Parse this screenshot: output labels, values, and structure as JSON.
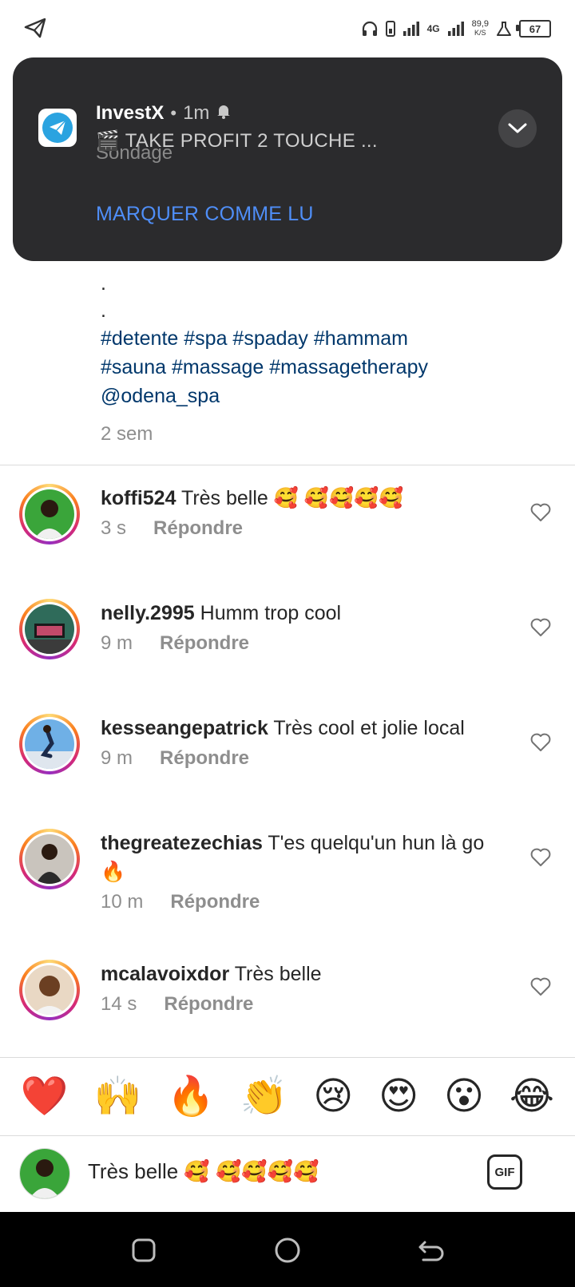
{
  "status_bar": {
    "network": "4G",
    "net_speed_value": "89,9",
    "net_speed_unit": "K/S",
    "battery": "67"
  },
  "notification": {
    "app_name": "InvestX",
    "time": "1m",
    "title": "🎬 TAKE PROFIT 2 TOUCHE ...",
    "subtitle": "Sondage",
    "action": "MARQUER COMME LU"
  },
  "caption": {
    "dots": [
      ".",
      "."
    ],
    "tags_line1": "#detente #spa #spaday #hammam",
    "tags_line2": "#sauna #massage #massagetherapy",
    "mention": "@odena_spa",
    "time": "2 sem"
  },
  "comments": [
    {
      "username": "koffi524",
      "text": "Très belle 🥰 🥰🥰🥰🥰",
      "time": "3 s",
      "reply": "Répondre"
    },
    {
      "username": "nelly.2995",
      "text": "Humm trop cool",
      "time": "9 m",
      "reply": "Répondre"
    },
    {
      "username": "kesseangepatrick",
      "text": "Très cool et jolie local",
      "time": "9 m",
      "reply": "Répondre"
    },
    {
      "username": "thegreatezechias",
      "text": "T'es quelqu'un hun là go🔥",
      "time": "10 m",
      "reply": "Répondre"
    },
    {
      "username": "mcalavoixdor",
      "text": "Très belle",
      "time": "14 s",
      "reply": "Répondre"
    }
  ],
  "reactions": [
    "❤️",
    "🙌",
    "🔥",
    "👏",
    "😢",
    "😍",
    "😮",
    "😂"
  ],
  "input": {
    "value": "Très belle 🥰 🥰🥰🥰🥰",
    "gif_label": "GIF"
  },
  "colors": {
    "link": "#00376b",
    "notif_bg": "#2b2b2d",
    "notif_action": "#4f8ef7",
    "meta": "#8e8e8e"
  }
}
